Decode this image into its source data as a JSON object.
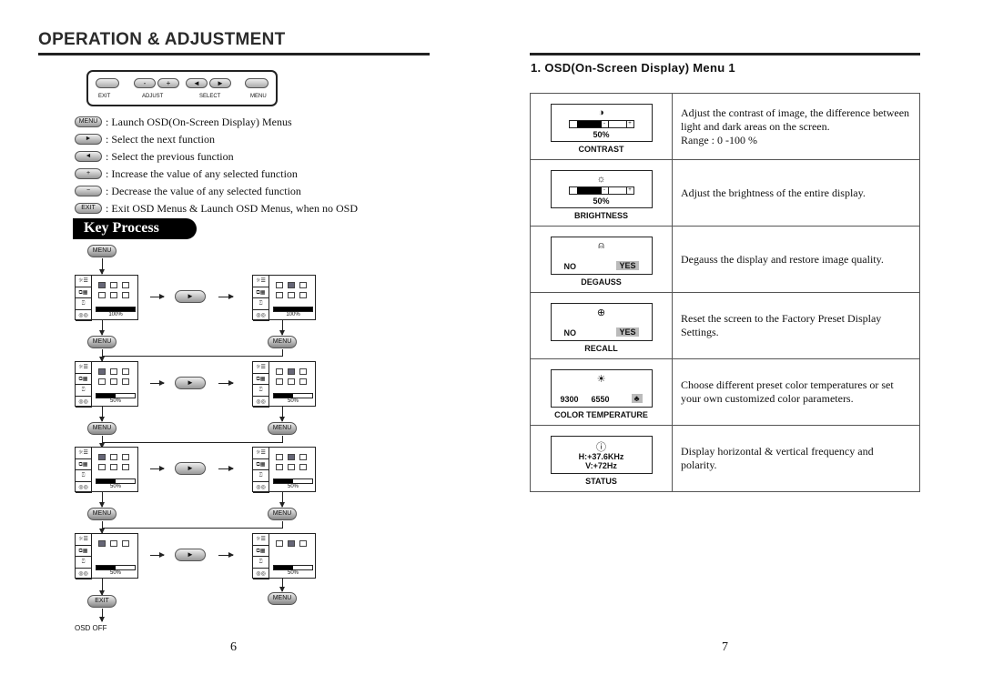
{
  "left_page": {
    "title": "OPERATION & ADJUSTMENT",
    "panel": {
      "exit": "EXIT",
      "adjust": "ADJUST",
      "select": "SELECT",
      "menu": "MENU",
      "minus": "-",
      "plus": "+",
      "left": "◄",
      "right": "►"
    },
    "legend": [
      {
        "key": "MENU",
        "text": ": Launch OSD(On-Screen Display) Menus"
      },
      {
        "key": "►",
        "text": ": Select the next function"
      },
      {
        "key": "◄",
        "text": ": Select the previous function"
      },
      {
        "key": "+",
        "text": ": Increase the value of any selected function"
      },
      {
        "key": "−",
        "text": ": Decrease the value of any selected function"
      },
      {
        "key": "EXIT",
        "text": ": Exit OSD Menus  &  Launch OSD Menus, when no OSD"
      }
    ],
    "key_process": "Key  Process",
    "menu_label": "MENU",
    "play_label": "►",
    "exit_label": "EXIT",
    "osd_off": "OSD OFF",
    "screens": [
      {
        "pct": "100%",
        "fill": 1.0
      },
      {
        "pct": "100%",
        "fill": 1.0
      },
      {
        "pct": "50%",
        "fill": 0.5
      },
      {
        "pct": "50%",
        "fill": 0.5
      },
      {
        "pct": "50%",
        "fill": 0.5
      },
      {
        "pct": "50%",
        "fill": 0.5
      },
      {
        "pct": "50%",
        "fill": 0.5
      },
      {
        "pct": "50%",
        "fill": 0.5
      }
    ],
    "page_number": "6"
  },
  "right_page": {
    "title": "1. OSD(On-Screen Display) Menu 1",
    "rows": [
      {
        "icon": "contrast-icon",
        "symbol": "◑",
        "type": "slider",
        "value": "50%",
        "fill": 0.5,
        "caption": "CONTRAST",
        "desc": "Adjust the contrast of image, the difference between light and dark areas on the screen.",
        "desc2": "Range  : 0 -100 %"
      },
      {
        "icon": "brightness-icon",
        "symbol": "☼",
        "type": "slider",
        "value": "50%",
        "fill": 0.5,
        "caption": "BRIGHTNESS",
        "desc": "Adjust the brightness of the entire display.",
        "desc2": ""
      },
      {
        "icon": "degauss-icon",
        "symbol": "⍝",
        "type": "yesno",
        "no": "NO",
        "yes": "YES",
        "caption": "DEGAUSS",
        "desc": "Degauss the display and restore image quality.",
        "desc2": ""
      },
      {
        "icon": "recall-icon",
        "symbol": "⊕",
        "type": "yesno",
        "no": "NO",
        "yes": "YES",
        "caption": "RECALL",
        "desc": "Reset the screen to the Factory Preset Display Settings.",
        "desc2": ""
      },
      {
        "icon": "color-temperature-icon",
        "symbol": "☀",
        "type": "color",
        "no": "9300",
        "mid": "6550",
        "yes": "♣",
        "caption": "COLOR TEMPERATURE",
        "desc": "Choose different preset color temperatures or set your own customized color parameters.",
        "desc2": ""
      },
      {
        "icon": "status-icon",
        "symbol": "ⓘ",
        "type": "status",
        "h": "H:+37.6KHz",
        "v": "V:+72Hz",
        "caption": "STATUS",
        "desc": "Display horizontal & vertical frequency and polarity.",
        "desc2": ""
      }
    ],
    "page_number": "7"
  }
}
